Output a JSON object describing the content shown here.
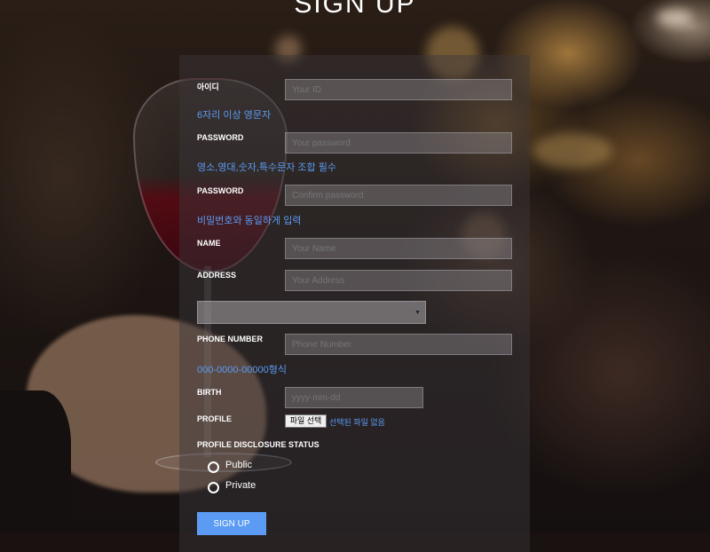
{
  "page": {
    "title": "SIGN UP"
  },
  "form": {
    "id": {
      "label": "아이디",
      "placeholder": "Your ID",
      "hint": "6자리 이상 영문자"
    },
    "password": {
      "label": "PASSWORD",
      "placeholder": "Your password",
      "hint": "영소,영대,숫자,특수문자 조합 필수"
    },
    "password_confirm": {
      "label": "PASSWORD",
      "placeholder": "Confirm password",
      "hint": "비밀번호와 동일하게 입력"
    },
    "name": {
      "label": "NAME",
      "placeholder": "Your Name"
    },
    "address": {
      "label": "ADDRESS",
      "placeholder": "Your Address",
      "select_value": ""
    },
    "phone": {
      "label": "PHONE NUMBER",
      "placeholder": "Phone Number",
      "hint": "000-0000-00000형식"
    },
    "birth": {
      "label": "BIRTH",
      "placeholder": "yyyy-mm-dd"
    },
    "profile": {
      "label": "PROFILE",
      "file_button": "파일 선택",
      "file_status": "선택된 파일 없음"
    },
    "disclosure": {
      "label": "PROFILE DISCLOSURE STATUS",
      "options": [
        "Public",
        "Private"
      ]
    },
    "submit_label": "SIGN UP"
  },
  "colors": {
    "accent": "#5b9bf3",
    "text": "#ffffff"
  }
}
